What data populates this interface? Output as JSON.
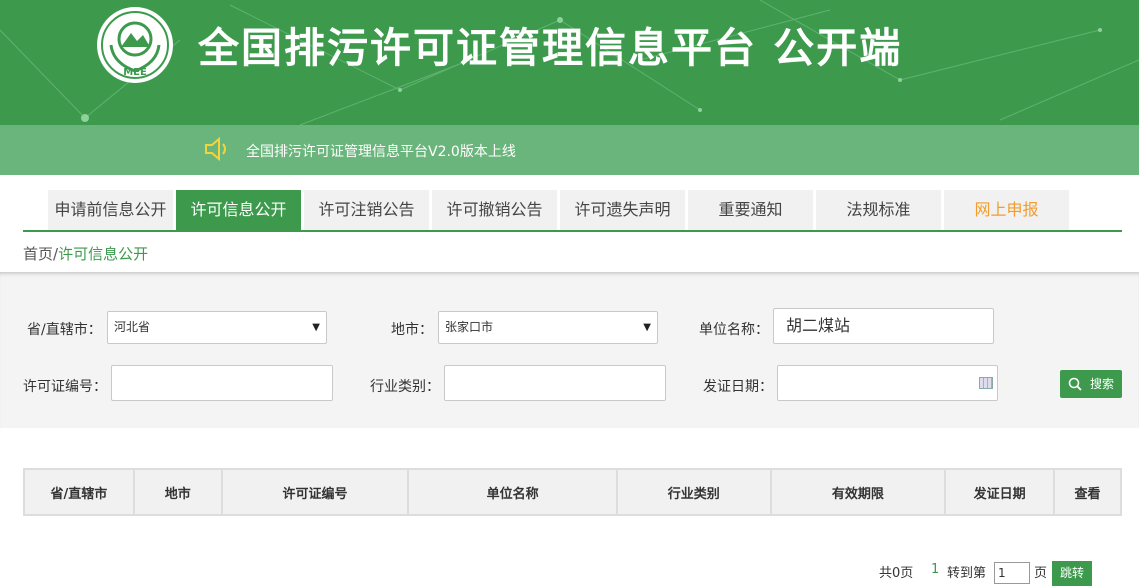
{
  "header": {
    "logo_text": "MEE",
    "title": "全国排污许可证管理信息平台  公开端",
    "notice": "全国排污许可证管理信息平台V2.0版本上线"
  },
  "tabs": [
    {
      "label": "申请前信息公开"
    },
    {
      "label": "许可信息公开",
      "active": true
    },
    {
      "label": "许可注销公告"
    },
    {
      "label": "许可撤销公告"
    },
    {
      "label": "许可遗失声明"
    },
    {
      "label": "重要通知"
    },
    {
      "label": "法规标准"
    },
    {
      "label": "网上申报"
    }
  ],
  "breadcrumb": {
    "home": "首页",
    "sep": "/",
    "current": "许可信息公开"
  },
  "filters": {
    "province_label": "省/直辖市：",
    "province_value": "河北省",
    "city_label": "地市：",
    "city_value": "张家口市",
    "unit_label": "单位名称：",
    "unit_value": "胡二煤站",
    "license_label": "许可证编号：",
    "license_value": "",
    "industry_label": "行业类别：",
    "industry_value": "",
    "date_label": "发证日期：",
    "date_value": "",
    "search_label": "搜索"
  },
  "table": {
    "columns": [
      "省/直辖市",
      "地市",
      "许可证编号",
      "单位名称",
      "行业类别",
      "有效期限",
      "发证日期",
      "查看"
    ]
  },
  "pager": {
    "total": "共0页",
    "current": "1",
    "goto_prefix": "转到第",
    "goto_value": "1",
    "goto_suffix": "页",
    "jump_label": "跳转"
  },
  "colors": {
    "brand_green": "#3d9a4d",
    "notice_green": "#6ab57c",
    "accent_orange": "#f39c2b"
  }
}
